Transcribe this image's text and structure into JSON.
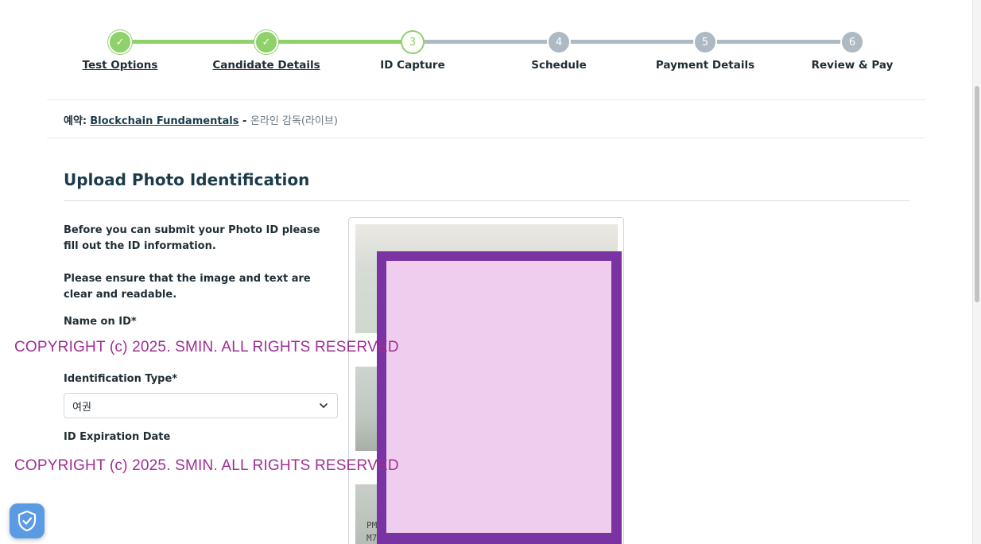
{
  "stepper": {
    "steps": [
      {
        "label": "Test Options",
        "marker": "✓",
        "state": "done"
      },
      {
        "label": "Candidate Details",
        "marker": "✓",
        "state": "done"
      },
      {
        "label": "ID Capture",
        "marker": "3",
        "state": "current"
      },
      {
        "label": "Schedule",
        "marker": "4",
        "state": "todo"
      },
      {
        "label": "Payment Details",
        "marker": "5",
        "state": "todo"
      },
      {
        "label": "Review & Pay",
        "marker": "6",
        "state": "todo"
      }
    ]
  },
  "booking": {
    "prefix": "예약:",
    "exam_name": "Blockchain Fundamentals",
    "separator": " - ",
    "mode": "온라인 감독(라이브)"
  },
  "section": {
    "title": "Upload Photo Identification",
    "intro": "Before you can submit your Photo ID please fill out the ID information.",
    "notice": "Please ensure that the image and text are clear and readable.",
    "name_label": "Name on ID*",
    "id_type_label": "Identification Type*",
    "id_type_value": "여권",
    "expiration_label": "ID Expiration Date"
  },
  "id_preview": {
    "mrz_lines": [
      "PM",
      "M7"
    ]
  },
  "watermark": {
    "text": "COPYRIGHT (c) 2025. SMIN.  ALL RIGHTS RESERVED"
  },
  "colors": {
    "done": "#8fd16a",
    "todo": "#adb9c3",
    "heading": "#1b3b4b",
    "watermark": "#a02d95",
    "redaction_border": "#7a33a3",
    "redaction_fill": "#efcdee",
    "shield": "#5a9be3"
  },
  "icons": {
    "dropdown": "chevron-down-icon",
    "privacy": "shield-check-icon"
  }
}
